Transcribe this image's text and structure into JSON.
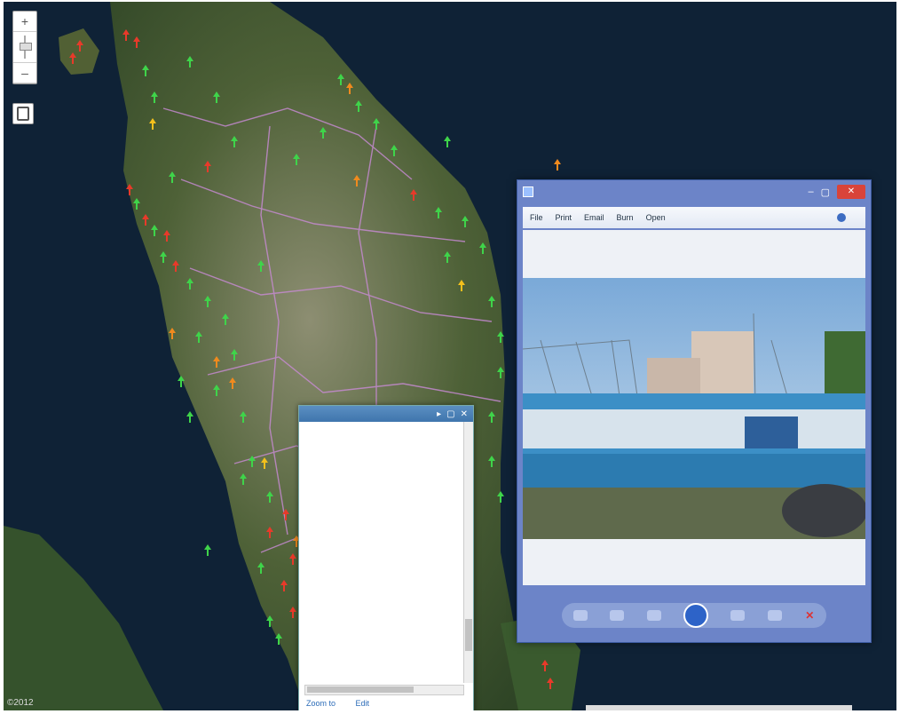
{
  "colors": {
    "red": "#e83a2a",
    "green": "#3fd44a",
    "orange": "#f08a1e",
    "yellow": "#f3c01c",
    "sea": "#0f2236",
    "land": "#4c5b3a"
  },
  "map": {
    "zoom_in": "+",
    "zoom_out": "–",
    "attribution": "©2012"
  },
  "popup": {
    "title": "",
    "rows": [
      {
        "k": "",
        "v": ""
      },
      {
        "k": "",
        "v": ""
      },
      {
        "k": "",
        "v": ""
      },
      {
        "k": "",
        "v": ""
      },
      {
        "k": "",
        "v": ""
      },
      {
        "k": "",
        "v": ""
      }
    ],
    "attachments_label": "",
    "attachment_link": "",
    "note": "",
    "footer": [
      "Zoom to",
      "",
      "Edit"
    ]
  },
  "viewer": {
    "title": "",
    "menu": [
      "File",
      "Print",
      "Email",
      "Burn",
      "Open"
    ]
  }
}
